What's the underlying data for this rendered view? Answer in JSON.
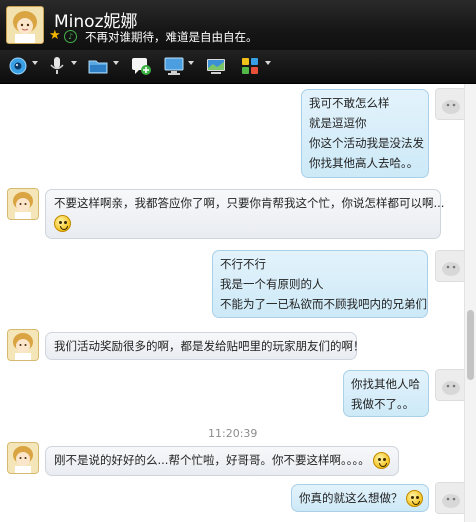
{
  "header": {
    "contact_name": "Minoz妮娜",
    "signature": "不再对谁期待，难道是自由自在。"
  },
  "toolbar": {
    "buttons": [
      {
        "icon": "webcam-icon"
      },
      {
        "icon": "microphone-icon"
      },
      {
        "icon": "file-transfer-icon"
      },
      {
        "icon": "add-chat-icon"
      },
      {
        "icon": "remote-desktop-icon"
      },
      {
        "icon": "app-share-icon"
      },
      {
        "icon": "apps-grid-icon"
      }
    ]
  },
  "chat": {
    "timestamp": "11:20:39",
    "messages": [
      {
        "from": "me",
        "lines": [
          "我可不敢怎么样",
          "就是逗逗你",
          "你这个活动我是没法发",
          "你找其他高人去哈。。"
        ]
      },
      {
        "from": "friend",
        "lines": [
          "不要这样啊亲，我都答应你了啊，只要你肯帮我这个忙，你说怎样都可以啊..."
        ],
        "emoji": "crying-face-emoji"
      },
      {
        "from": "me",
        "lines": [
          "不行不行",
          "我是一个有原则的人",
          "不能为了一已私欲而不顾我吧内的兄弟们"
        ]
      },
      {
        "from": "friend",
        "lines": [
          "我们活动奖励很多的啊，都是发给贴吧里的玩家朋友们的啊！"
        ]
      },
      {
        "from": "me",
        "lines": [
          "你找其他人哈",
          "我做不了。。"
        ]
      },
      {
        "from": "friend",
        "lines": [
          "刚不是说的好好的么...帮个忙啦，好哥哥。你不要这样啊。。。。"
        ],
        "emoji": "awkward-face-emoji"
      },
      {
        "from": "me",
        "lines": [
          "你真的就这么想做？"
        ],
        "emoji": "laughing-tears-emoji"
      }
    ]
  },
  "colors": {
    "header_bg": "#1c1c1c",
    "outgoing_bubble": "#d6edf9",
    "incoming_bubble": "#eef0f4",
    "star": "#f0b400"
  }
}
